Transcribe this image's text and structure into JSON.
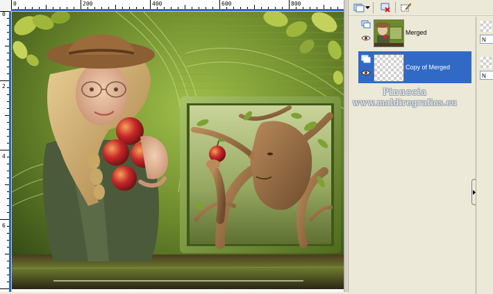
{
  "ruler": {
    "top_labels": [
      "0",
      "200",
      "400",
      "600",
      "800"
    ],
    "left_labels": [
      "0",
      "2",
      "4",
      "6"
    ]
  },
  "layers": {
    "items": [
      {
        "name": "Merged",
        "thumb": "image",
        "selected": false
      },
      {
        "name": "Copy of Merged",
        "thumb": "transparent",
        "selected": true
      }
    ],
    "right_fields": [
      "N",
      "N"
    ]
  },
  "watermark": {
    "line1": "Pinuccia",
    "line2": "www.maldiregrafics.eu"
  },
  "icons": [
    "new-raster-layer-icon",
    "dropdown-arrow-icon",
    "delete-layer-icon",
    "edit-brush-icon",
    "visibility-eye-icon",
    "expand-arrow-icon"
  ],
  "colors": {
    "selection": "#316ac5",
    "panel": "#ece9d8",
    "art_green": "#5f7a28"
  }
}
